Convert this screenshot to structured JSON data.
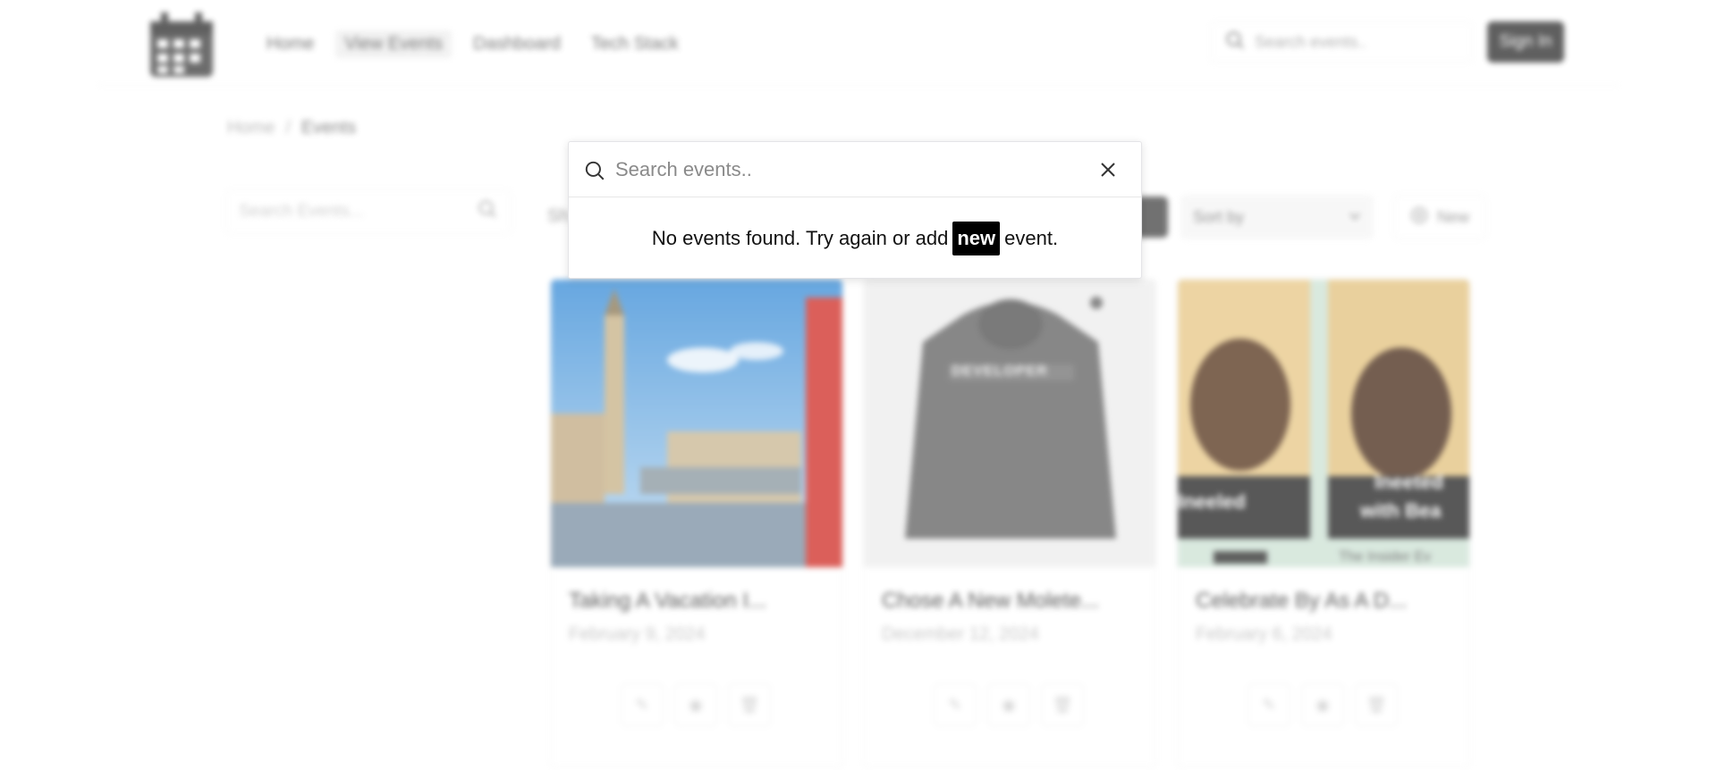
{
  "nav": {
    "items": [
      {
        "label": "Home"
      },
      {
        "label": "View Events"
      },
      {
        "label": "Dashboard"
      },
      {
        "label": "Tech Stack"
      }
    ],
    "search_placeholder": "Search events..",
    "sign_in_label": "Sign In"
  },
  "breadcrumb": {
    "home": "Home",
    "separator": "/",
    "current": "Events"
  },
  "sidebar": {
    "search_placeholder": "Search Events..."
  },
  "toolbar": {
    "filter_label": "Sh",
    "sort_placeholder": "Sort by",
    "new_label": "New"
  },
  "cards": [
    {
      "title": "Taking A Vacation I...",
      "date": "February 9, 2024"
    },
    {
      "title": "Chose A New Molete...",
      "date": "December 12, 2024"
    },
    {
      "title": "Celebrate By As A D...",
      "date": "February 6, 2024"
    }
  ],
  "card_overlays": {
    "hoodie_text": "DEVELOPER",
    "poster_left_text": "Ineeled",
    "poster_right_text_1": "Ineeted",
    "poster_right_text_2": "with Bea",
    "poster_caption": "The Insider Ev"
  },
  "dialog": {
    "placeholder": "Search events..",
    "message_before": "No events found. Try again or add",
    "message_highlight": "new",
    "message_after": "event."
  },
  "colors": {
    "highlight_bg": "#000000",
    "sign_in_bg": "#333333"
  }
}
